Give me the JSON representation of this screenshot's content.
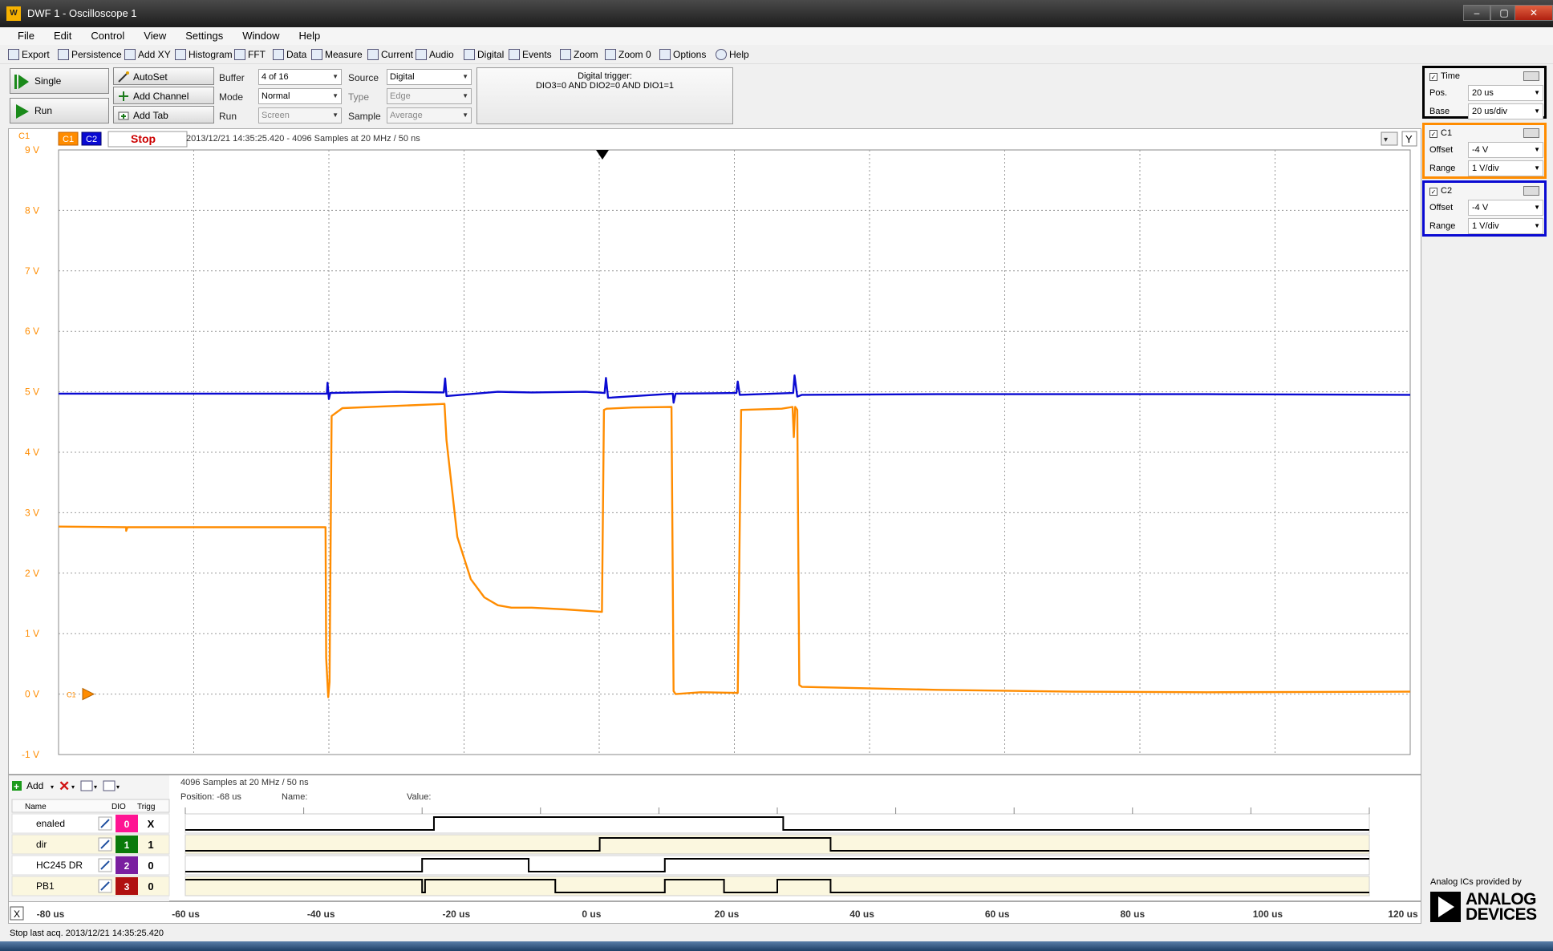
{
  "window": {
    "title": "DWF 1 - Oscilloscope 1"
  },
  "menu": [
    "File",
    "Edit",
    "Control",
    "View",
    "Settings",
    "Window",
    "Help"
  ],
  "toolbar": [
    "Export",
    "Persistence",
    "Add XY",
    "Histogram",
    "FFT",
    "Data",
    "Measure",
    "Current",
    "Audio",
    "Digital",
    "Events",
    "Zoom",
    "Zoom 0",
    "Options",
    "Help"
  ],
  "control": {
    "single": "Single",
    "run": "Run",
    "autoset": "AutoSet",
    "add_channel": "Add Channel",
    "add_tab": "Add Tab",
    "buffer_label": "Buffer",
    "buffer_value": "4 of 16",
    "mode_label": "Mode",
    "mode_value": "Normal",
    "run_label": "Run",
    "run_value": "Screen",
    "source_label": "Source",
    "source_value": "Digital",
    "type_label": "Type",
    "type_value": "Edge",
    "sample_label": "Sample",
    "sample_value": "Average",
    "trigger_title": "Digital trigger:",
    "trigger_condition": "DIO3=0 AND DIO2=0 AND DIO1=1"
  },
  "panels": {
    "time": {
      "title": "Time",
      "pos_label": "Pos.",
      "pos_value": "20 us",
      "base_label": "Base",
      "base_value": "20 us/div"
    },
    "c1": {
      "title": "C1",
      "offset_label": "Offset",
      "offset_value": "-4 V",
      "range_label": "Range",
      "range_value": "1 V/div"
    },
    "c2": {
      "title": "C2",
      "offset_label": "Offset",
      "offset_value": "-4 V",
      "range_label": "Range",
      "range_value": "1 V/div"
    }
  },
  "scope": {
    "channel_label": "C1",
    "c1_tag": "C1",
    "c2_tag": "C2",
    "stop_label": "Stop",
    "info": "2013/12/21 14:35:25.420 - 4096 Samples at 20 MHz / 50 ns",
    "y_button": "Y",
    "marker_label": "C1"
  },
  "colors": {
    "c1": "#ff8c00",
    "c2": "#0a0ad2",
    "stop": "#cc0000"
  },
  "chart_data": {
    "type": "line",
    "ylim": [
      -1,
      9
    ],
    "xlim": [
      -70,
      130
    ],
    "yticks": [
      "9 V",
      "8 V",
      "7 V",
      "6 V",
      "5 V",
      "4 V",
      "3 V",
      "2 V",
      "1 V",
      "0 V",
      "-1 V"
    ],
    "xticks": [
      "-80 us",
      "-60 us",
      "-40 us",
      "-20 us",
      "0 us",
      "20 us",
      "40 us",
      "60 us",
      "80 us",
      "100 us",
      "120 us"
    ],
    "series": [
      {
        "name": "C1",
        "color": "#ff8c00",
        "x": [
          -70,
          -60,
          -60,
          -59.8,
          -30.5,
          -30.4,
          -30.1,
          -29.9,
          -29.6,
          -28,
          -12.9,
          -12.6,
          -11,
          -9,
          -7,
          -5,
          -3,
          0,
          5,
          10.4,
          10.7,
          11.1,
          15,
          20.7,
          21,
          21.3,
          25,
          30.3,
          30.5,
          31,
          37,
          38.6,
          38.8,
          39.0,
          39.3,
          39.6,
          40,
          60,
          80,
          100,
          130
        ],
        "y": [
          2.77,
          2.76,
          2.7,
          2.76,
          2.76,
          0.6,
          -0.05,
          0.2,
          4.6,
          4.73,
          4.8,
          4.2,
          2.6,
          1.9,
          1.6,
          1.47,
          1.43,
          1.43,
          1.4,
          1.36,
          4.7,
          4.72,
          4.74,
          4.75,
          0.05,
          0.0,
          0.03,
          0.02,
          0.02,
          4.7,
          4.72,
          4.75,
          4.25,
          4.75,
          4.7,
          0.15,
          0.12,
          0.07,
          0.04,
          0.03,
          0.04
        ]
      },
      {
        "name": "C2",
        "color": "#0a0ad2",
        "x": [
          -70,
          -30.3,
          -30.2,
          -30,
          -29.8,
          -20,
          -13,
          -12.8,
          -12.6,
          -5,
          0,
          8,
          10.8,
          11,
          11.3,
          20.9,
          21,
          21.3,
          30.3,
          30.5,
          30.8,
          38.7,
          38.9,
          39.3,
          40,
          60,
          100,
          130
        ],
        "y": [
          4.97,
          4.97,
          5.15,
          4.88,
          4.98,
          5.0,
          4.99,
          5.22,
          4.93,
          5.0,
          4.99,
          5.0,
          4.98,
          5.23,
          4.9,
          4.97,
          4.82,
          4.97,
          4.98,
          5.17,
          4.95,
          4.98,
          5.27,
          4.92,
          4.95,
          4.96,
          4.96,
          4.95
        ]
      }
    ]
  },
  "logic": {
    "add_label": "Add",
    "info": "4096 Samples at 20 MHz / 50 ns",
    "position_label": "Position: -68 us",
    "name_label": "Name:",
    "value_label": "Value:",
    "col_name": "Name",
    "col_dio": "DIO",
    "col_trig": "Trigg",
    "x_label": "X",
    "channels": [
      {
        "name": "enaled",
        "dio": "0",
        "trig": "X",
        "color": "#ff1493",
        "x": [
          -70,
          -28,
          31,
          130
        ],
        "v": [
          0,
          1,
          0,
          0
        ]
      },
      {
        "name": "dir",
        "dio": "1",
        "trig": "1",
        "color": "#0a7a0a",
        "x": [
          -70,
          0,
          39,
          130
        ],
        "v": [
          0,
          1,
          0,
          0
        ]
      },
      {
        "name": "HC245 DR",
        "dio": "2",
        "trig": "0",
        "color": "#7a1fa0",
        "x": [
          -70,
          -30,
          -12,
          11,
          130
        ],
        "v": [
          0,
          1,
          0,
          1,
          1
        ]
      },
      {
        "name": "PB1",
        "dio": "3",
        "trig": "0",
        "color": "#b01010",
        "x": [
          -70,
          -30,
          -29.5,
          -7.5,
          0,
          11,
          21,
          30,
          39,
          130
        ],
        "v": [
          1,
          0,
          1,
          0,
          0,
          1,
          0,
          1,
          0,
          0
        ]
      }
    ]
  },
  "status": {
    "text": "Stop last acq. 2013/12/21  14:35:25.420"
  },
  "brand": {
    "small": "Analog ICs provided by",
    "line1": "ANALOG",
    "line2": "DEVICES"
  }
}
